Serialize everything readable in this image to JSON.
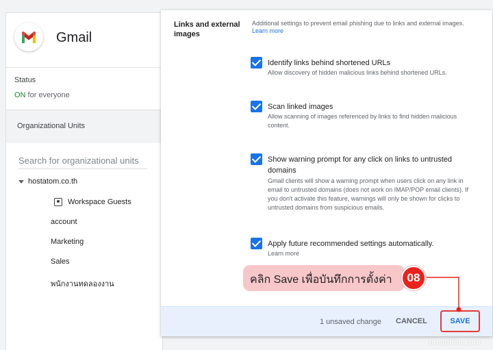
{
  "app": {
    "title": "Gmail"
  },
  "status": {
    "label": "Status",
    "value_on": "ON",
    "value_rest": " for everyone"
  },
  "ou": {
    "header": "Organizational Units",
    "search_placeholder": "Search for organizational units",
    "root": "hostatom.co.th",
    "items": [
      "Workspace Guests",
      "account",
      "Marketing",
      "Sales",
      "พนักงานทดลองงาน"
    ]
  },
  "section": {
    "title": "Links and external images",
    "description": "Additional settings to prevent email phishing due to links and external images.",
    "learn_more": "Learn more"
  },
  "options": [
    {
      "title": "Identify links behind shortened URLs",
      "description": "Allow discovery of hidden malicious links behind shortened URLs.",
      "checked": true
    },
    {
      "title": "Scan linked images",
      "description": "Allow scanning of images referenced by links to find hidden malicious content.",
      "checked": true
    },
    {
      "title": "Show warning prompt for any click on links to untrusted domains",
      "description": "Gmail clients will show a warning prompt when users click on any link in email to untrusted domains (does not work on IMAP/POP email clients). If you don't activate this feature, warnings will only be shown for clicks to untrusted domains from suspicious emails.",
      "checked": true
    },
    {
      "title": "Apply future recommended settings automatically.",
      "description": "Learn more",
      "checked": true
    }
  ],
  "footer": {
    "unsaved": "1 unsaved change",
    "cancel": "CANCEL",
    "save": "SAVE"
  },
  "callout": {
    "text": "คลิก Save เพื่อบันทึกการตั้งค่า",
    "step": "08"
  },
  "watermark": "hostatom.com",
  "colors": {
    "accent": "#1a73e8",
    "callout_bg": "#f8c7c9",
    "step_red": "#e8231b",
    "status_on": "#188038"
  }
}
